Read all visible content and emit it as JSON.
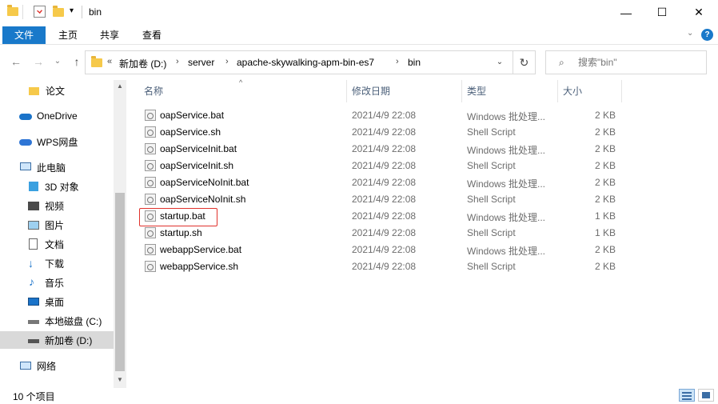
{
  "window": {
    "title": "bin",
    "minimize": "—",
    "maximize": "☐",
    "close": "✕"
  },
  "ribbon": {
    "tabs": [
      "文件",
      "主页",
      "共享",
      "查看"
    ],
    "collapse": "⌄",
    "help": "?"
  },
  "address": {
    "back": "←",
    "forward": "→",
    "recent": "⌄",
    "up": "↑",
    "overflow": "«",
    "crumbs": [
      "新加卷 (D:)",
      "server",
      "apache-skywalking-apm-bin-es7",
      "bin"
    ],
    "separator": "›",
    "dropdown": "⌄",
    "refresh": "↻"
  },
  "search": {
    "icon": "⌕",
    "placeholder": "搜索\"bin\""
  },
  "nav": {
    "items": [
      {
        "label": "论文",
        "icon": "folder-icon"
      },
      {
        "label": "OneDrive",
        "icon": "cloud-icon"
      },
      {
        "label": "WPS网盘",
        "icon": "wps-cloud-icon"
      },
      {
        "label": "此电脑",
        "icon": "computer-icon"
      },
      {
        "label": "3D 对象",
        "icon": "cube-icon"
      },
      {
        "label": "视频",
        "icon": "video-icon"
      },
      {
        "label": "图片",
        "icon": "picture-icon"
      },
      {
        "label": "文档",
        "icon": "document-icon"
      },
      {
        "label": "下载",
        "icon": "download-icon"
      },
      {
        "label": "音乐",
        "icon": "music-icon"
      },
      {
        "label": "桌面",
        "icon": "desktop-icon"
      },
      {
        "label": "本地磁盘 (C:)",
        "icon": "drive-c-icon"
      },
      {
        "label": "新加卷 (D:)",
        "icon": "drive-icon"
      },
      {
        "label": "网络",
        "icon": "network-icon"
      }
    ],
    "selected_index": 12,
    "scroll_up": "▲",
    "scroll_down": "▼"
  },
  "columns": {
    "name": "名称",
    "modified": "修改日期",
    "type": "类型",
    "size": "大小",
    "sort_indicator": "^"
  },
  "files": [
    {
      "name": "oapService.bat",
      "modified": "2021/4/9 22:08",
      "type": "Windows 批处理...",
      "size": "2 KB"
    },
    {
      "name": "oapService.sh",
      "modified": "2021/4/9 22:08",
      "type": "Shell Script",
      "size": "2 KB"
    },
    {
      "name": "oapServiceInit.bat",
      "modified": "2021/4/9 22:08",
      "type": "Windows 批处理...",
      "size": "2 KB"
    },
    {
      "name": "oapServiceInit.sh",
      "modified": "2021/4/9 22:08",
      "type": "Shell Script",
      "size": "2 KB"
    },
    {
      "name": "oapServiceNoInit.bat",
      "modified": "2021/4/9 22:08",
      "type": "Windows 批处理...",
      "size": "2 KB"
    },
    {
      "name": "oapServiceNoInit.sh",
      "modified": "2021/4/9 22:08",
      "type": "Shell Script",
      "size": "2 KB"
    },
    {
      "name": "startup.bat",
      "modified": "2021/4/9 22:08",
      "type": "Windows 批处理...",
      "size": "1 KB"
    },
    {
      "name": "startup.sh",
      "modified": "2021/4/9 22:08",
      "type": "Shell Script",
      "size": "1 KB"
    },
    {
      "name": "webappService.bat",
      "modified": "2021/4/9 22:08",
      "type": "Windows 批处理...",
      "size": "2 KB"
    },
    {
      "name": "webappService.sh",
      "modified": "2021/4/9 22:08",
      "type": "Shell Script",
      "size": "2 KB"
    }
  ],
  "highlighted_file_index": 6,
  "status": {
    "item_count": "10 个项目"
  },
  "colors": {
    "accent": "#1979ca",
    "highlight_box": "#e0322c",
    "selected_nav": "#d9d9d9"
  }
}
